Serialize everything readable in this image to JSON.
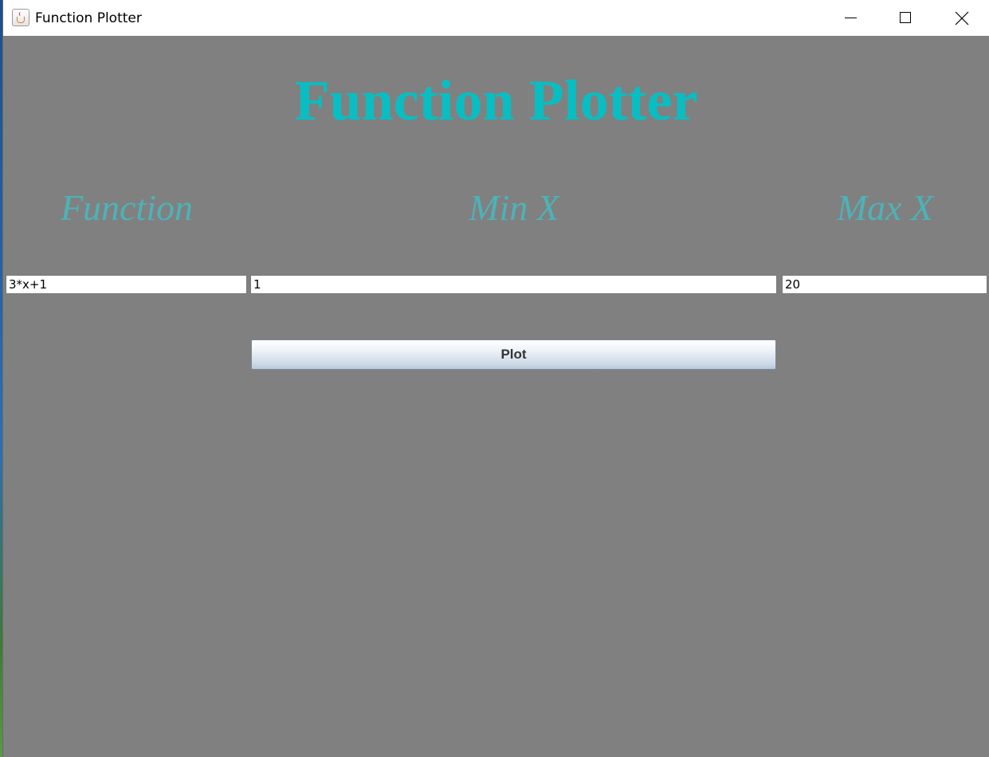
{
  "window": {
    "title": "Function Plotter",
    "icon": "java-cup-icon",
    "background": "#808080",
    "controls": {
      "minimize_icon": "minimize-icon",
      "maximize_icon": "maximize-icon",
      "close_icon": "close-icon"
    }
  },
  "main": {
    "heading": "Function Plotter",
    "heading_color": "#08bec2",
    "label_color": "#4cb3b8",
    "labels": {
      "function": "Function",
      "min_x": "Min X",
      "max_x": "Max X"
    },
    "inputs": {
      "function": "3*x+1",
      "min_x": "1",
      "max_x": "20"
    },
    "plot_button": "Plot"
  }
}
